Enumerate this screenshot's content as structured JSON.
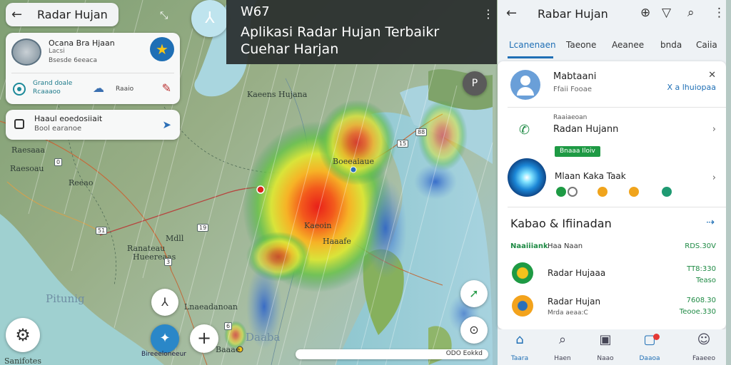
{
  "left_panel": {
    "title": "Radar Hujan",
    "card1": {
      "title": "Ocana Bra Hjaan",
      "line2": "Lacsi",
      "line3": "Bsesde  6eeaca",
      "chip1": "Grand doale",
      "chip2": "Rcaaaoo",
      "chip3": "Raaio"
    },
    "card2": {
      "title": "Haaul eoedosiiait",
      "subtitle": "Bool earanoe"
    },
    "locate_label": "Bireeeloneeur"
  },
  "banner": {
    "code": "W67",
    "line1": "Aplikasi Radar Hujan Terbaikr",
    "line2": "Cuehar Harjan"
  },
  "map_labels": {
    "l1": "Raesaaa",
    "l2": "Reeao",
    "l3": "Raesoau",
    "l4": "Mdll",
    "l5": "Ranateau",
    "l6": "Hueereaas",
    "l7": "Pitunig",
    "l8": "Kaeens Hujana",
    "l9": "Boeeaiaue",
    "l10": "Kaeoin",
    "l11": "Haaafe",
    "l12": "Daaba",
    "l13": "Lnaeadanoan",
    "l14": "Baaae",
    "l15": "Sanifotes"
  },
  "scale_text": "ODO Eokkd",
  "right_panel": {
    "header_title": "Rabar Hujan",
    "tabs": [
      "Lcanenaen",
      "Taeone",
      "Aeanee",
      "bnda",
      "Caiia"
    ],
    "profile": {
      "name": "Mabtaani",
      "subtitle": "Ffaii Fooae",
      "link": "X a lhuiopaa"
    },
    "small_label": "Raaiaeoan",
    "item1": "Radan Hujann",
    "chip": "Bnaaa Iloiv",
    "item2": "Mlaan Kaka Taak",
    "section_title": "Kabao & Ifiinadan",
    "row_head": {
      "a": "Naaiiiank",
      "b": "Haa Naan",
      "c": "RDS.30V"
    },
    "rows": [
      {
        "name": "Radar Hujaaa",
        "sub": "",
        "v1": "TT8:330",
        "v2": ""
      },
      {
        "name": "Radar Hujan",
        "sub": "Mrda aeaa:C",
        "v1": "7608.30",
        "v2": ""
      }
    ],
    "extra_values": [
      "Teaso",
      "Teooe.330"
    ],
    "bottom_nav": [
      "Taara",
      "Haen",
      "Naao",
      "Daaoa",
      "Faaeeo"
    ]
  },
  "colors": {
    "accent": "#1f6fb5",
    "green": "#1e9a44",
    "banner_bg": "#2c3030"
  }
}
